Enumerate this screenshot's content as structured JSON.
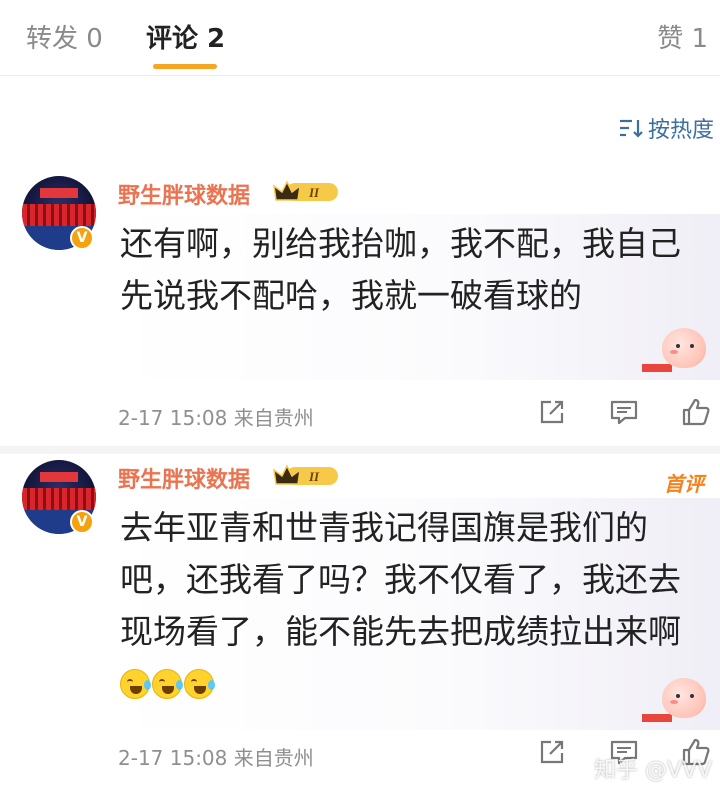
{
  "tabs": {
    "repost": "转发 0",
    "comment": "评论 2",
    "like": "赞 1"
  },
  "sort": {
    "label": "按热度",
    "icon": "sort-lines-icon"
  },
  "comments": [
    {
      "username": "野生胖球数据",
      "rank_badge": "II",
      "text": "还有啊，别给我抬咖，我不配，我自己先说我不配哈，我就一破看球的",
      "time": "2-17 15:08",
      "location": "来自贵州",
      "first_tag": "",
      "emoji_count": 0
    },
    {
      "username": "野生胖球数据",
      "rank_badge": "II",
      "text": "去年亚青和世青我记得国旗是我们的吧，还我看了吗？我不仅看了，我还去现场看了，能不能先去把成绩拉出来啊",
      "time": "2-17 15:08",
      "location": "来自贵州",
      "first_tag": "首评",
      "emoji_count": 3
    }
  ],
  "watermark": "知乎 @VVV",
  "colors": {
    "accent": "#f5a623",
    "username": "#eb7350",
    "link": "#3c6e9f",
    "meta": "#8f8f8f"
  }
}
